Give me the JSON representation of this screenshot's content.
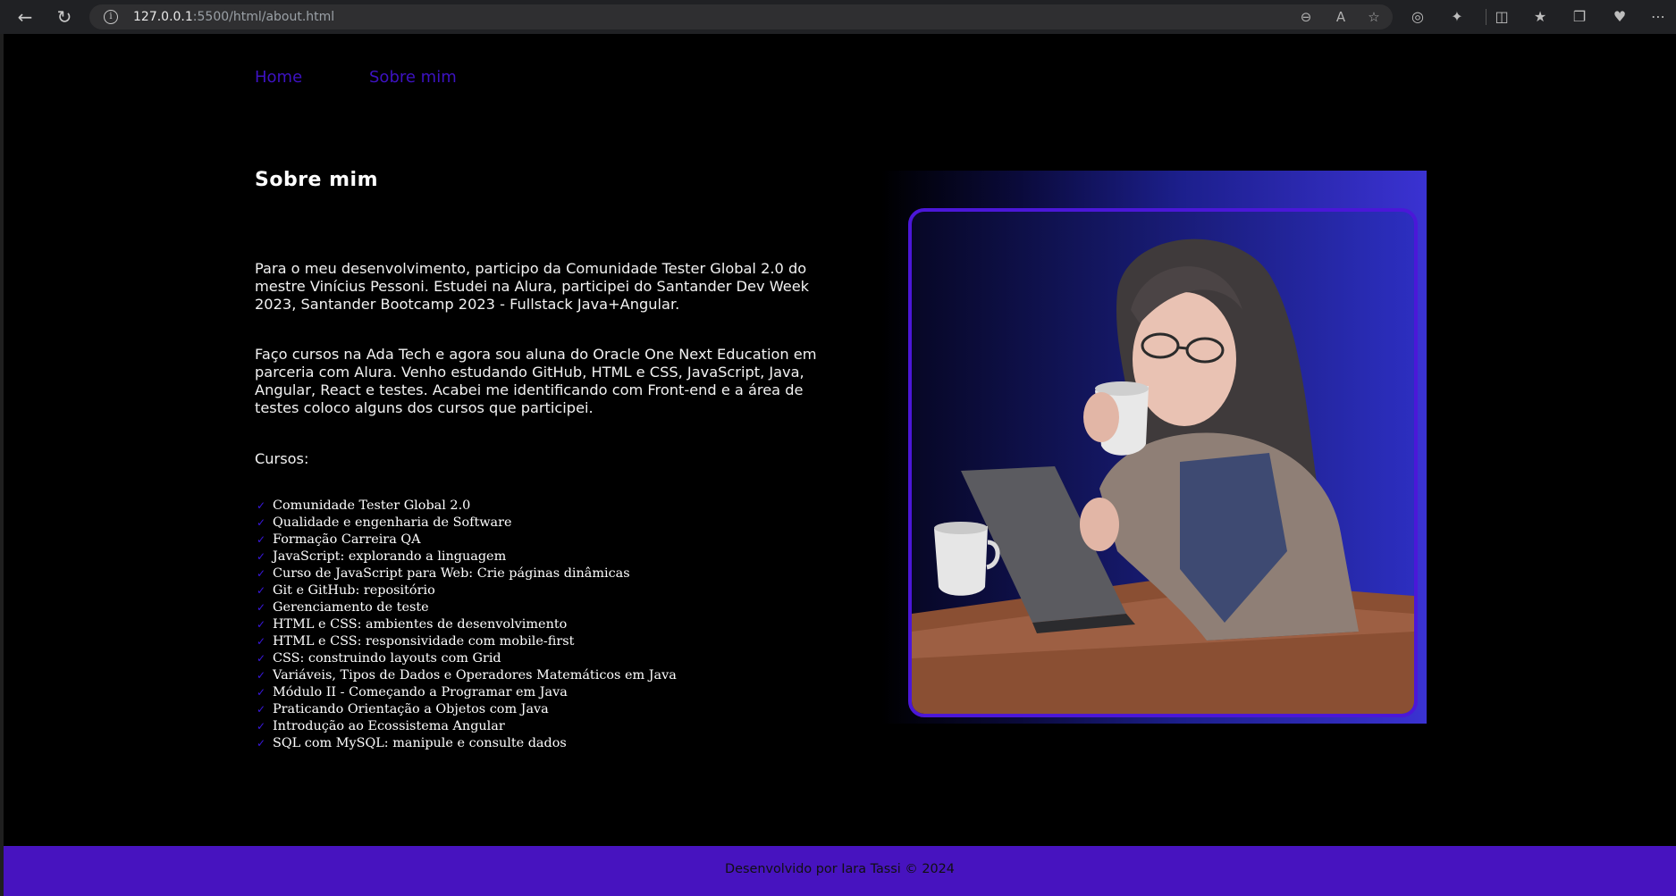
{
  "browser": {
    "url_host": "127.0.0.1",
    "url_path": ":5500/html/about.html"
  },
  "nav": {
    "home": "Home",
    "about": "Sobre mim"
  },
  "main": {
    "title": "Sobre mim",
    "paragraph1": "Para o meu desenvolvimento, participo da Comunidade Tester Global 2.0 do mestre Vinícius Pessoni. Estudei na Alura, participei do Santander Dev Week 2023, Santander Bootcamp 2023 - Fullstack Java+Angular.",
    "paragraph2": "Faço cursos na Ada Tech e agora sou aluna do Oracle One Next Education em parceria com Alura. Venho estudando GitHub, HTML e CSS, JavaScript, Java, Angular, React e testes. Acabei me identificando com Front-end e a área de testes coloco alguns dos cursos que participei.",
    "courses_label": "Cursos:",
    "courses": [
      "Comunidade Tester Global 2.0",
      "Qualidade e engenharia de Software",
      "Formação Carreira QA",
      "JavaScript: explorando a linguagem",
      "Curso de JavaScript para Web: Crie páginas dinâmicas",
      "Git e GitHub: repositório",
      "Gerenciamento de teste",
      "HTML e CSS: ambientes de desenvolvimento",
      "HTML e CSS: responsividade com mobile-first",
      "CSS: construindo layouts com Grid",
      "Variáveis, Tipos de Dados e Operadores Matemáticos em Java",
      "Módulo II - Começando a Programar em Java",
      "Praticando Orientação a Objetos com Java",
      "Introdução ao Ecossistema Angular",
      "SQL com MySQL: manipule e consulte dados"
    ]
  },
  "footer": {
    "text": "Desenvolvido por Iara Tassi © 2024"
  },
  "colors": {
    "nav_link": "#3d12c2",
    "footer_bg": "#4713bf",
    "check": "#3a18e0",
    "frame_border": "#4b17d8"
  }
}
